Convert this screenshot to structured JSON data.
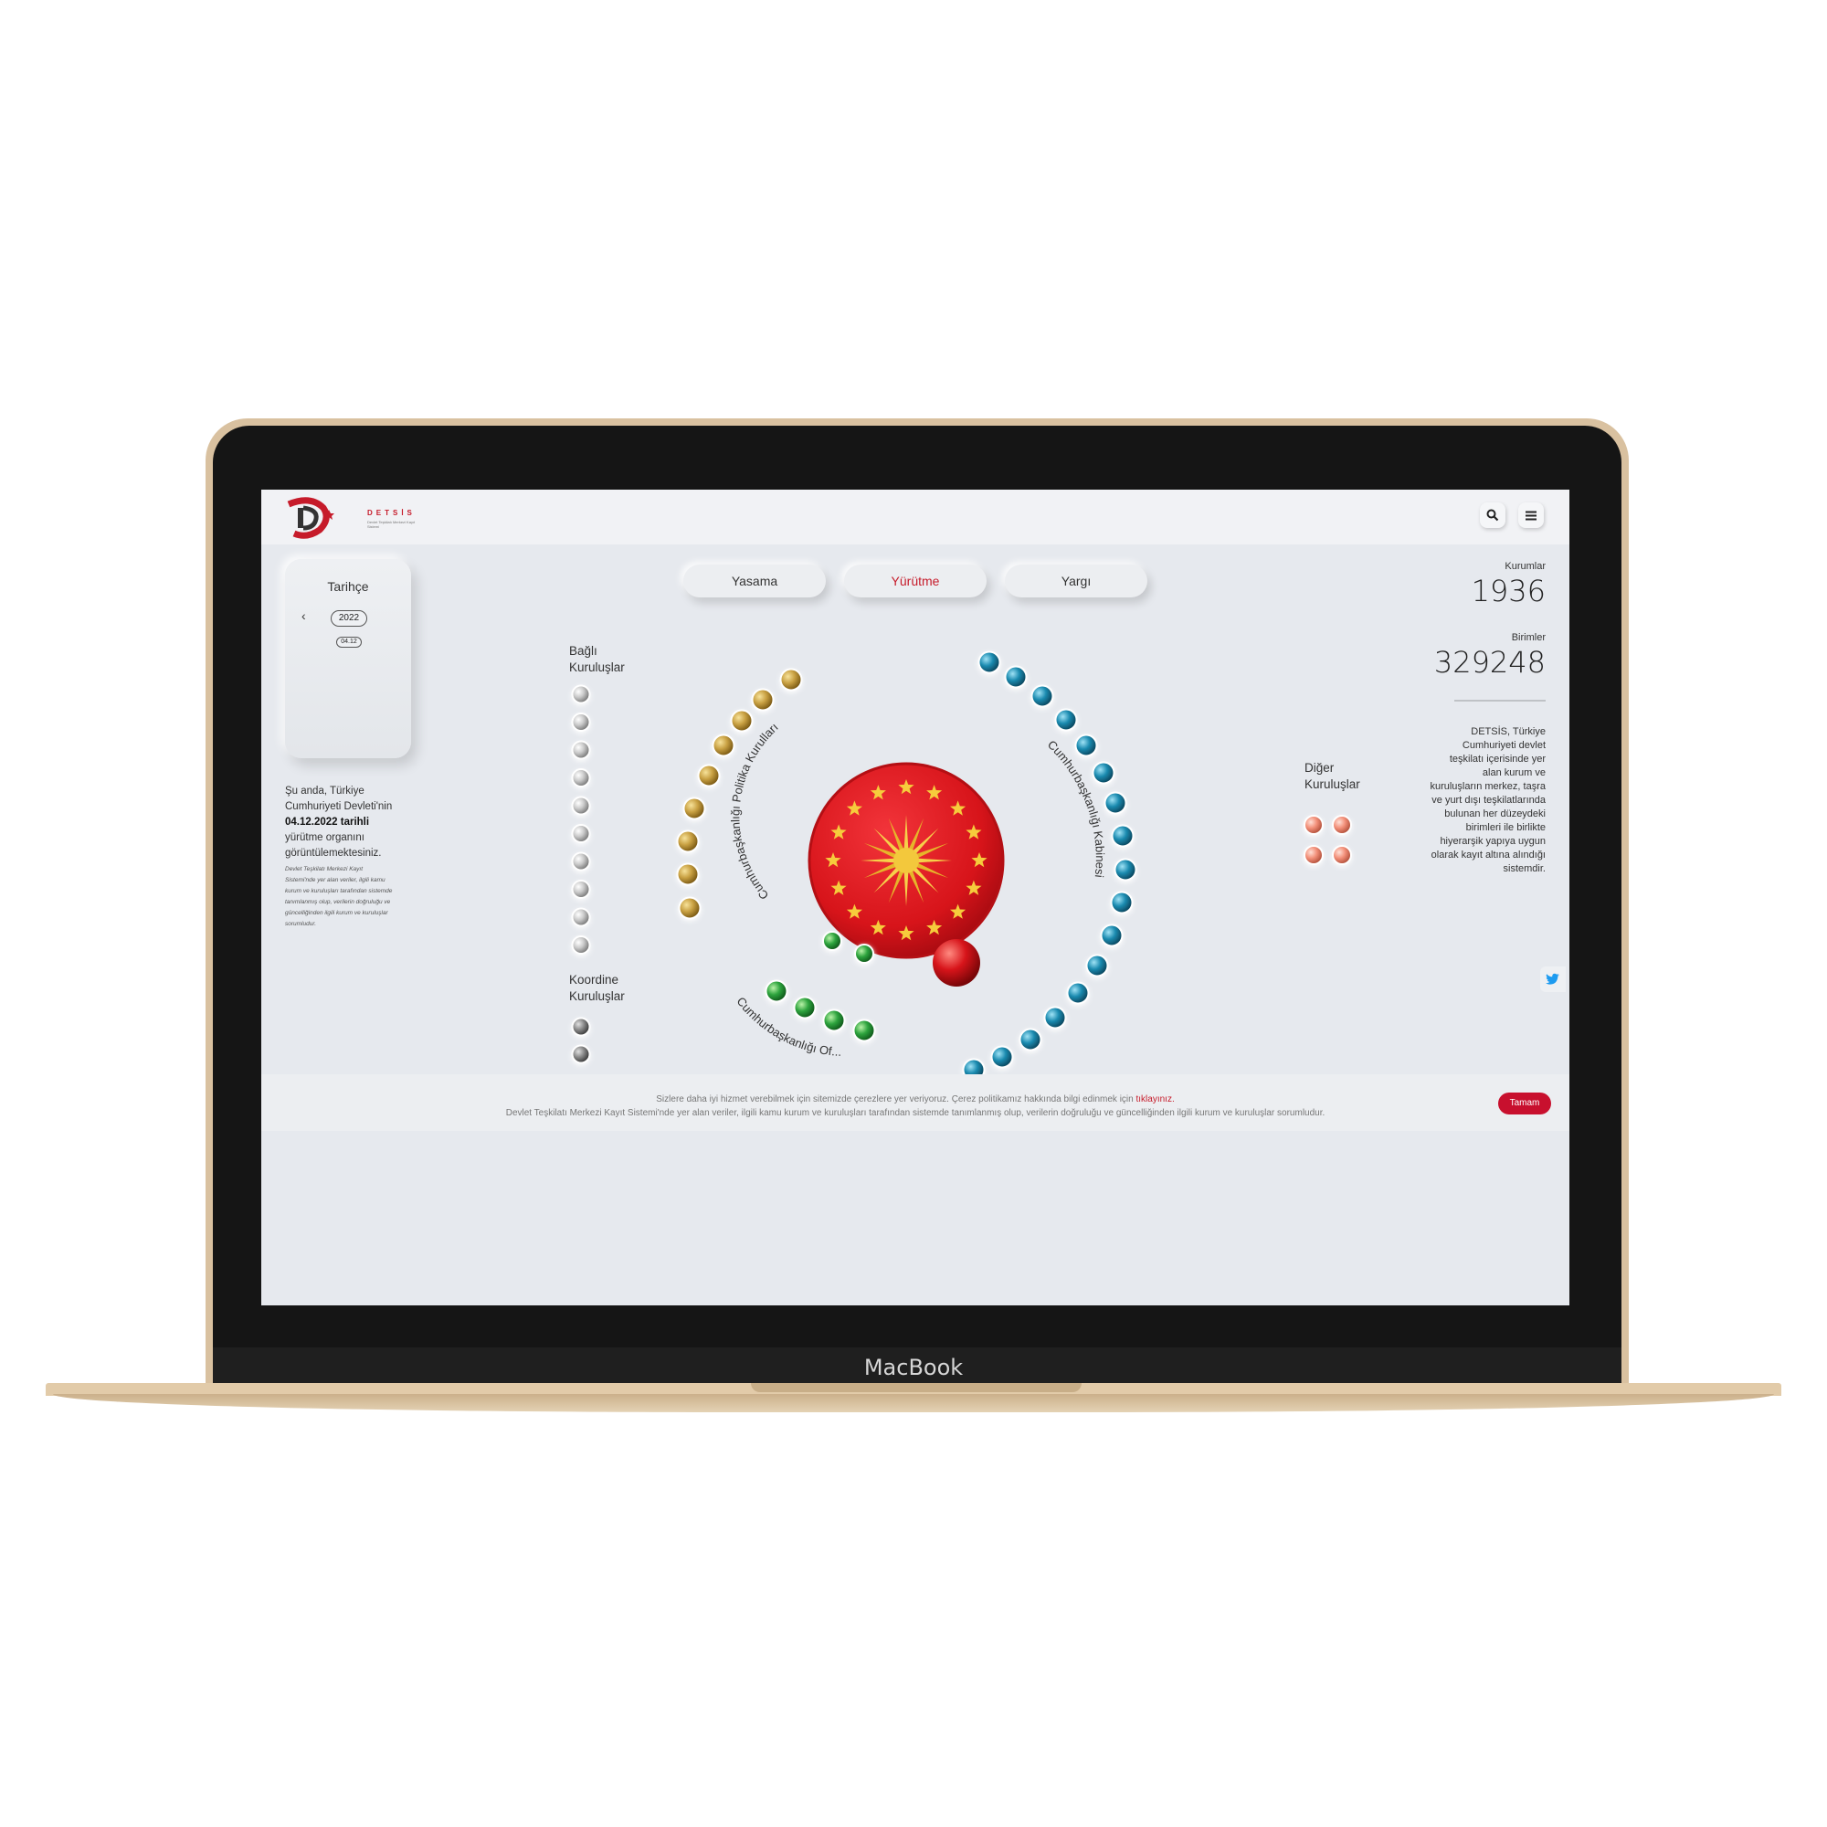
{
  "device": {
    "brand": "MacBook"
  },
  "header": {
    "logo_text": "DETSİS",
    "logo_sub": "Devlet Teşkilatı Merkezi Kayıt Sistemi"
  },
  "history": {
    "title": "Tarihçe",
    "prev_icon": "chevron-left-icon",
    "year": "2022",
    "date": "04.12"
  },
  "intro": {
    "line1": "Şu anda, Türkiye Cumhuriyeti Devleti'nin",
    "date_bold": "04.12.2022 tarihli",
    "line2": "yürütme organını görüntülemektesiniz.",
    "fine": "Devlet Teşkilatı Merkezi Kayıt Sistemi'nde yer alan veriler, ilgili kamu kurum ve kuruluşları tarafından sistemde tanımlanmış olup, verilerin doğruluğu ve güncelliğinden ilgili kurum ve kuruluşlar sorumludur."
  },
  "tabs": [
    {
      "label": "Yasama",
      "active": false
    },
    {
      "label": "Yürütme",
      "active": true
    },
    {
      "label": "Yargı",
      "active": false
    }
  ],
  "groups": {
    "bagli": "Bağlı Kuruluşlar",
    "koordine": "Koordine Kuruluşlar",
    "diger": "Diğer Kuruluşlar",
    "politika": "Cumhurbaşkanlığı Politika Kurulları",
    "kabine": "Cumhurbaşkanlığı Kabinesi",
    "ofisler": "Cumhurbaşkanlığı Of..."
  },
  "stats": {
    "kurumlar_label": "Kurumlar",
    "kurumlar_value": "1936",
    "birimler_label": "Birimler",
    "birimler_value": "329248"
  },
  "about": "DETSİS, Türkiye Cumhuriyeti devlet teşkilatı içerisinde yer alan kurum ve kuruluşların merkez, taşra ve yurt dışı teşkilatlarında bulunan her düzeydeki birimleri ile birlikte hiyerarşik yapıya uygun olarak kayıt altına alındığı sistemdir.",
  "cookie": {
    "line1": "Sizlere daha iyi hizmet verebilmek için sitemizde çerezlere yer veriyoruz. Çerez politikamız hakkında bilgi edinmek için ",
    "link": "tıklayınız.",
    "line2": "Devlet Teşkilatı Merkezi Kayıt Sistemi'nde yer alan veriler, ilgili kamu kurum ve kuruluşları tarafından sistemde tanımlanmış olup, verilerin doğruluğu ve güncelliğinden ilgili kurum ve kuruluşlar sorumludur.",
    "button": "Tamam"
  },
  "colors": {
    "brand_red": "#c61b2a",
    "seal_red": "#d7141a",
    "gold": "#b98e2c",
    "teal": "#1b8bb0",
    "green": "#2e9a3e",
    "silver": "#b8b8b8",
    "salmon": "#f08a74"
  }
}
